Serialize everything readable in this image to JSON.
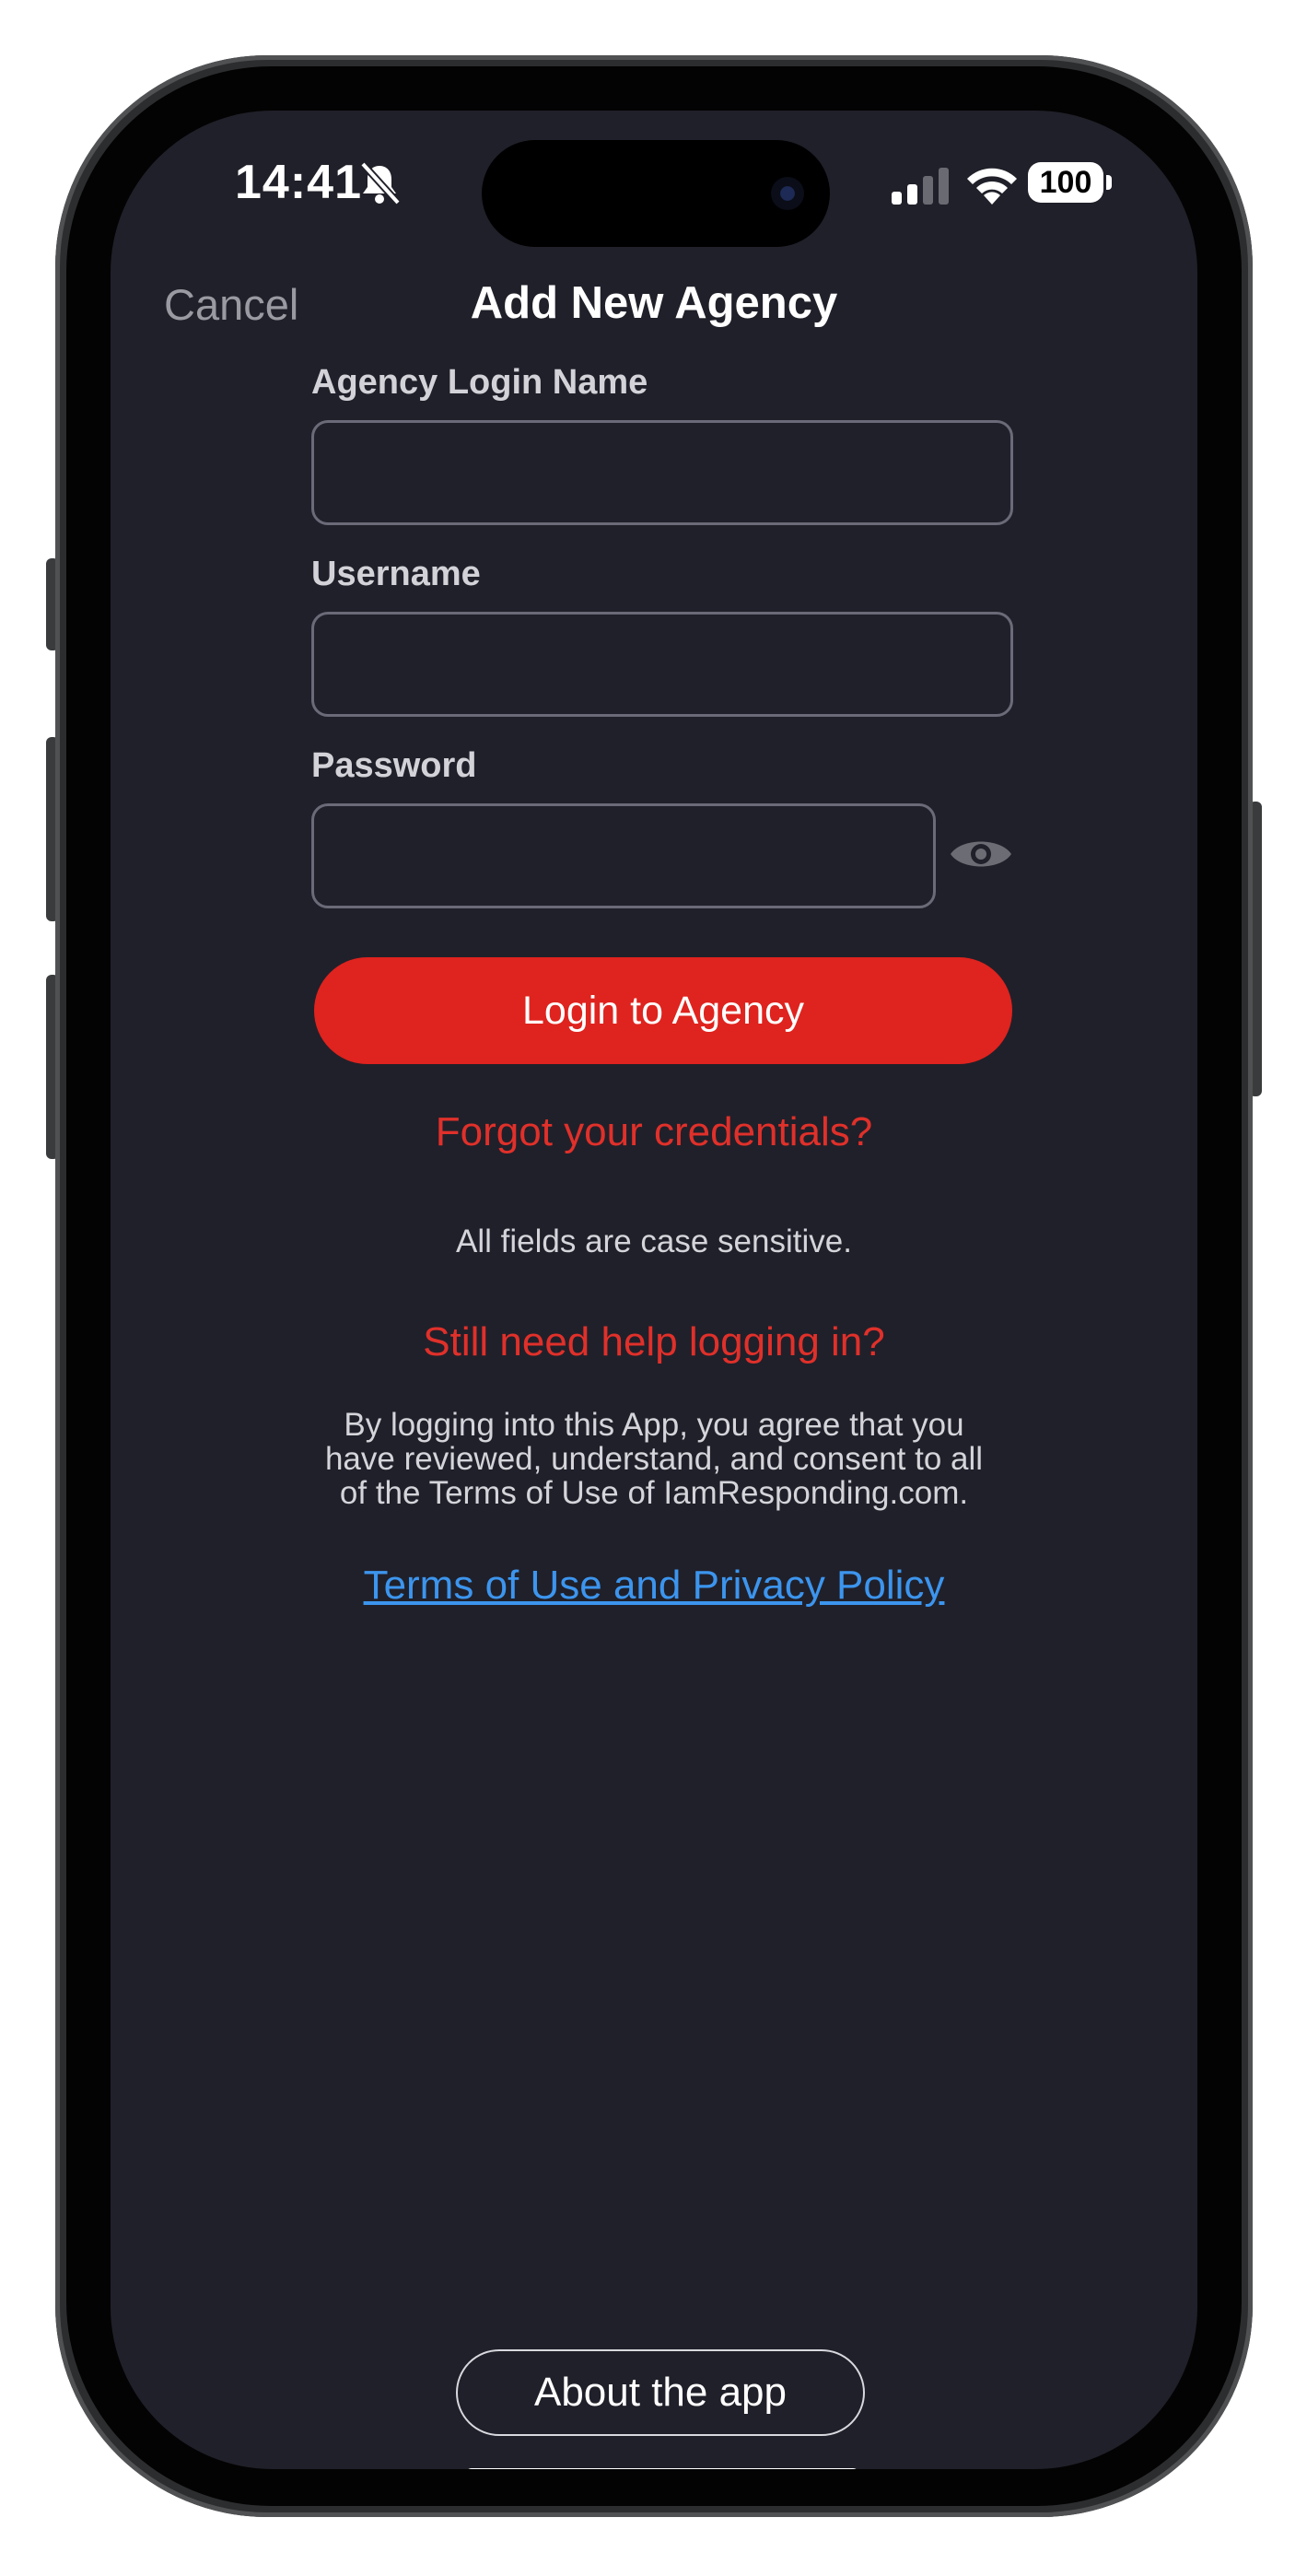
{
  "status_bar": {
    "time": "14:41",
    "battery": "100",
    "icons": [
      "bell-slash-icon",
      "cellular-signal-icon",
      "wifi-icon",
      "battery-icon"
    ]
  },
  "nav": {
    "cancel_label": "Cancel",
    "title": "Add New Agency"
  },
  "form": {
    "agency_label": "Agency Login Name",
    "agency_value": "",
    "username_label": "Username",
    "username_value": "",
    "password_label": "Password",
    "password_value": "",
    "show_password_icon": "eye-icon",
    "login_label": "Login to Agency"
  },
  "help": {
    "forgot_label": "Forgot your credentials?",
    "case_note": "All fields are case sensitive.",
    "still_help_label": "Still need help logging in?",
    "consent_lines": [
      "By logging into this App, you agree that you",
      "have reviewed, understand, and consent to all",
      "of the Terms of Use of IamResponding.com."
    ],
    "terms_label": "Terms of Use and Privacy Policy"
  },
  "footer": {
    "about_label": "About the app"
  },
  "colors": {
    "background": "#20202a",
    "accent_red": "#df231e",
    "link_blue": "#3c95ee",
    "field_border": "#6a6a78"
  }
}
